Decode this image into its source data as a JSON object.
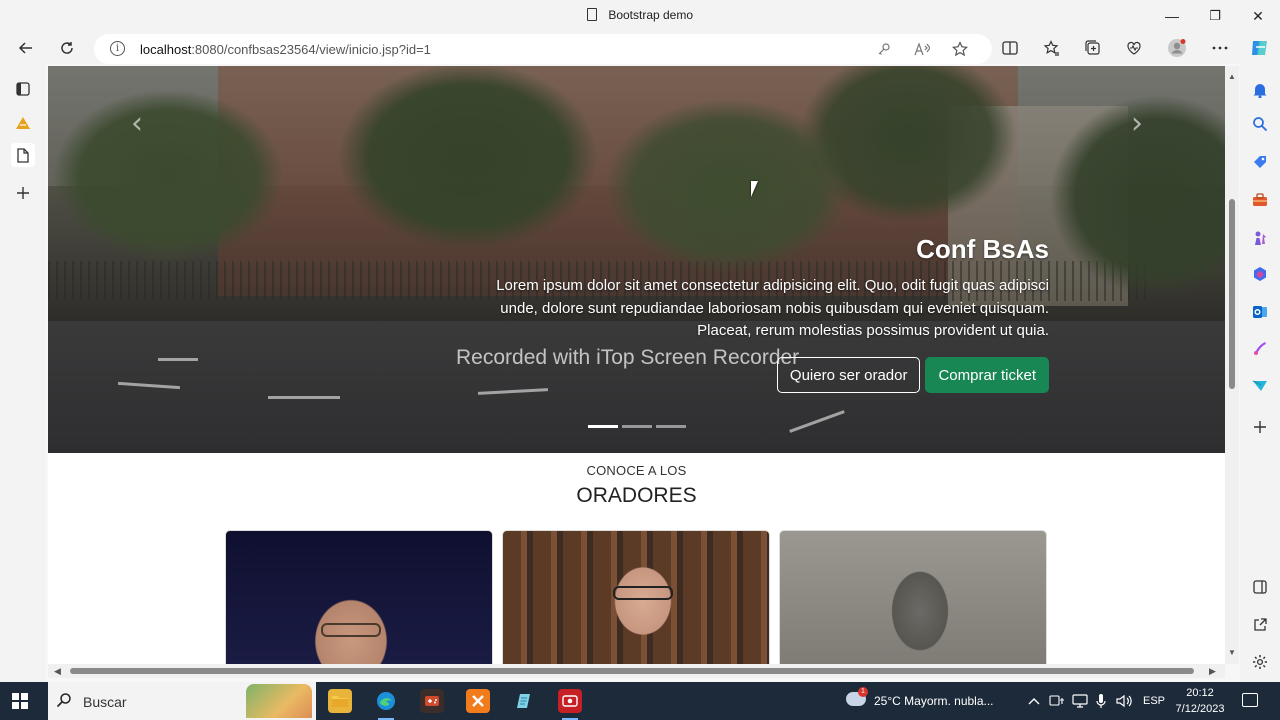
{
  "window": {
    "title": "Bootstrap demo",
    "minimize": "—",
    "maximize": "❐",
    "close": "✕"
  },
  "browser": {
    "url_host": "localhost",
    "url_rest": ":8080/confbsas23564/view/inicio.jsp?id=1",
    "info_icon": "i"
  },
  "hero": {
    "title": "Conf BsAs",
    "text": "Lorem ipsum dolor sit amet consectetur adipisicing elit. Quo, odit fugit quas adipisci unde, dolore sunt repudiandae laboriosam nobis quibusdam qui eveniet quisquam. Placeat, rerum molestias possimus provident ut quia.",
    "btn_speaker": "Quiero ser orador",
    "btn_ticket": "Comprar ticket",
    "prev": "‹",
    "next": "›",
    "watermark": "Recorded with iTop Screen Recorder",
    "slide_count": 3,
    "active_slide": 1,
    "colors": {
      "ticket_button": "#198754"
    }
  },
  "speakers": {
    "subtitle": "CONOCE A LOS",
    "title": "ORADORES"
  },
  "taskbar": {
    "search_label": "Buscar",
    "weather": "25°C  Mayorm. nubla...",
    "weather_badge": "1",
    "lang": "ESP",
    "time": "20:12",
    "date": "7/12/2023"
  }
}
